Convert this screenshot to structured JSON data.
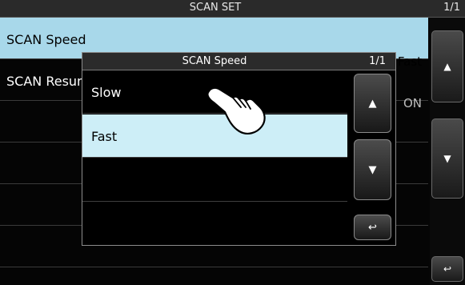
{
  "header": {
    "title": "SCAN SET",
    "page": "1/1"
  },
  "list": [
    {
      "label": "SCAN Speed",
      "value": "Fast",
      "selected": true
    },
    {
      "label": "SCAN Resume",
      "value": "ON",
      "selected": false
    }
  ],
  "dialog": {
    "title": "SCAN Speed",
    "page": "1/1",
    "options": [
      {
        "label": "Slow",
        "selected": false
      },
      {
        "label": "Fast",
        "selected": true
      }
    ]
  },
  "icons": {
    "scroll_up": "▲",
    "scroll_down": "▼",
    "back": "↩"
  },
  "colors": {
    "highlight": "#a8d8ea",
    "dialog_highlight": "#cdeef7"
  }
}
